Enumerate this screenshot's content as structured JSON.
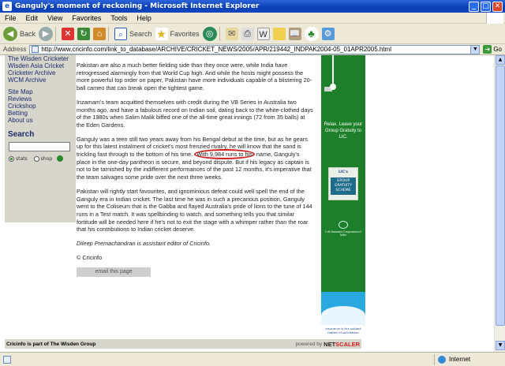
{
  "window": {
    "title": "Ganguly's moment of reckoning - Microsoft Internet Explorer"
  },
  "menu": [
    "File",
    "Edit",
    "View",
    "Favorites",
    "Tools",
    "Help"
  ],
  "toolbar": {
    "back_label": "Back",
    "search_label": "Search",
    "favorites_label": "Favorites"
  },
  "address": {
    "label": "Address",
    "url": "http://www.cricinfo.com/link_to_database/ARCHIVE/CRICKET_NEWS/2005/APR/219442_INDPAK2004-05_01APR2005.html",
    "go_label": "Go"
  },
  "leftnav": {
    "group1": [
      "The Wisden Cricketer",
      "Wisden Asia Cricket",
      "Cricketer Archive",
      "WCM Archive"
    ],
    "group2": [
      "Site Map",
      "Reviews",
      "Crickshop",
      "Betting",
      "About us"
    ],
    "search_title": "Search",
    "radio_stats": "stats",
    "radio_shop": "shop"
  },
  "article": {
    "p1": "Pakistan are also a much better fielding side than they once were, while India have retrogressed alarmingly from that World Cup high. And while the hosts might possess the more powerful top order on paper, Pakistan have more individuals capable of a blistering 20-ball cameo that can break open the tightest game.",
    "p2": "Inzamam's team acquitted themselves with credit during the VB Series in Australia two months ago, and have a fabulous record on Indian soil, dating back to the white-clothed days of the 1980s when Salim Malik biffed one of the all-time great innings (72 from 35 balls) at the Eden Gardens.",
    "p3a": "Ganguly was a teen still two years away from his Bengal debut at the time, but as he gears up for this latest instalment of cricket's most frenzied rivalry, he will know that the sand is trickling fast through to the bottom of his time. ",
    "p3_highlight": "With 9,984 runs to his",
    "p3b": " name, Ganguly's place in the one-day pantheon is secure, and beyond dispute. But if his legacy as captain is not to be tarnished by the indifferent performances of the past 12 months, it's imperative that the team salvages some pride over the next three weeks.",
    "p4": "Pakistan will rightly start favourites, and ignominious defeat could well spell the end of the Ganguly era in Indian cricket. The last time he was in such a precarious position, Ganguly went to the Coliseum that is the Gabba and flayed Australia's pride of lions to the tune of 144 runs in a Test match. It was spellbinding to watch, and something tells you that similar fortitude will be needed here if he's not to exit the stage with a whimper rather than the roar that his contributions to Indian cricket deserve.",
    "byline": "Dileep Premachandran is assistant editor of Cricinfo.",
    "copyright": "© Cricinfo",
    "email_button": "email this page"
  },
  "ad": {
    "headline": "Relax. Leave your Group Gratuity to LIC.",
    "badge_top": "LIC's",
    "badge_mid": "GROUP GRATUITY SCHEME",
    "corp": "Life Insurance Corporation of India",
    "tagline": "Insurance is the subject matter of solicitation"
  },
  "footer": {
    "left": "Cricinfo is part of The Wisden Group",
    "powered": "powered by",
    "net": "NET",
    "scaler": "SCALER"
  },
  "status": {
    "zone": "Internet"
  }
}
